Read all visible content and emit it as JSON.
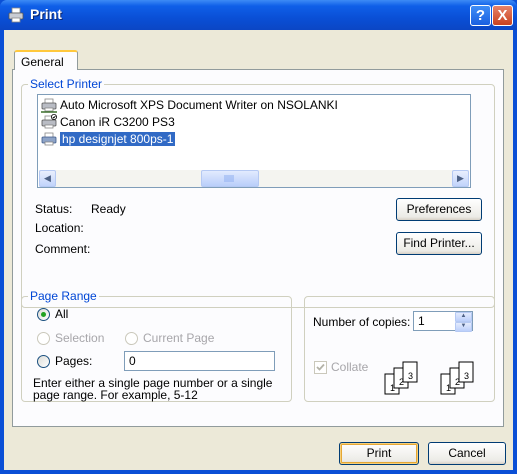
{
  "title": "Print",
  "titlebar_buttons": {
    "help": "?",
    "close": "X"
  },
  "tabs": [
    {
      "label": "General"
    }
  ],
  "select_printer": {
    "legend": "Select Printer",
    "printers": [
      {
        "name": "Auto Microsoft XPS Document Writer on NSOLANKI",
        "icon": "network-printer-icon"
      },
      {
        "name": "Canon iR C3200 PS3",
        "icon": "default-printer-icon"
      },
      {
        "name": "hp designjet 800ps-1",
        "icon": "printer-icon",
        "selected": true
      }
    ],
    "status_label": "Status:",
    "status_value": "Ready",
    "location_label": "Location:",
    "comment_label": "Comment:",
    "preferences_button": "Preferences",
    "find_printer_button": "Find Printer..."
  },
  "page_range": {
    "legend": "Page Range",
    "all_label": "All",
    "selection_label": "Selection",
    "current_page_label": "Current Page",
    "pages_label": "Pages:",
    "pages_value": "0",
    "help_text_line1": "Enter either a single page number or a single",
    "help_text_line2": "page range.  For example, 5-12"
  },
  "copies": {
    "number_label": "Number of copies:",
    "number_value": "1",
    "collate_label": "Collate",
    "collate_checked": true,
    "collate_page_numbers": [
      "1",
      "2",
      "3",
      "1",
      "2",
      "3"
    ]
  },
  "footer": {
    "print_button": "Print",
    "cancel_button": "Cancel"
  },
  "colors": {
    "title_bar": "#0a4fd6",
    "legend_text": "#0046d5",
    "selection": "#316ac5"
  }
}
